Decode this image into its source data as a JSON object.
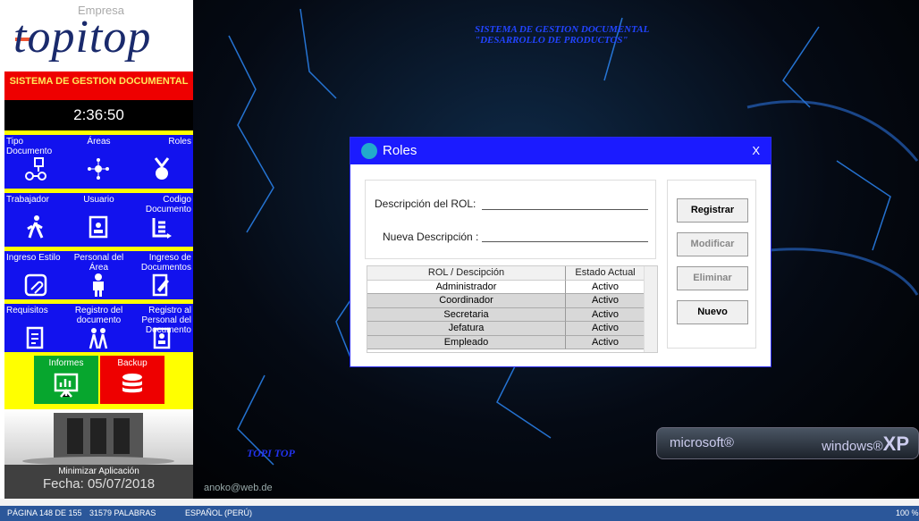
{
  "sidebar": {
    "company": "Empresa",
    "logo": "topitop",
    "system_title": "SISTEMA DE GESTION DOCUMENTAL",
    "clock": "2:36:50",
    "row1": [
      {
        "label": "Tipo Documento",
        "icon": "flow-icon"
      },
      {
        "label": "Áreas",
        "icon": "network-icon"
      },
      {
        "label": "Roles",
        "icon": "medal-icon"
      }
    ],
    "row2": [
      {
        "label": "Trabajador",
        "icon": "walking-person-icon"
      },
      {
        "label": "Usuario",
        "icon": "id-badge-icon"
      },
      {
        "label": "Codigo Documento",
        "icon": "list-arrow-icon"
      }
    ],
    "row3": [
      {
        "label": "Ingreso Estilo",
        "icon": "clip-icon"
      },
      {
        "label": "Personal del Área",
        "icon": "person-tie-icon"
      },
      {
        "label": "Ingreso de Documentos",
        "icon": "edit-doc-icon"
      }
    ],
    "row4": [
      {
        "label": "Requisitos",
        "icon": "checklist-icon"
      },
      {
        "label": "Registro del documento",
        "icon": "people-icon"
      },
      {
        "label": "Registro al Personal del Documento",
        "icon": "badge-doc-icon"
      }
    ],
    "informes": "Informes",
    "backup": "Backup",
    "minimize": "Minimizar Aplicación",
    "date": "Fecha: 05/07/2018"
  },
  "desktop": {
    "title_line1": "SISTEMA DE GESTION DOCUMENTAL",
    "title_line2": "\"DESARROLLO DE PRODUCTOS\"",
    "topitop": "TOPI TOP",
    "email": "anoko@web.de",
    "microsoft": "microsoft®",
    "windows": "windows®",
    "xp": "XP"
  },
  "dialog": {
    "title": "Roles",
    "close": "X",
    "desc_label": "Descripción del ROL:",
    "new_label": "Nueva Descripción :",
    "col1": "ROL / Descipción",
    "col2": "Estado Actual",
    "rows": [
      {
        "rol": "Administrador",
        "estado": "Activo"
      },
      {
        "rol": "Coordinador",
        "estado": "Activo"
      },
      {
        "rol": "Secretaria",
        "estado": "Activo"
      },
      {
        "rol": "Jefatura",
        "estado": "Activo"
      },
      {
        "rol": "Empleado",
        "estado": "Activo"
      }
    ],
    "buttons": {
      "registrar": "Registrar",
      "modificar": "Modificar",
      "eliminar": "Eliminar",
      "nuevo": "Nuevo"
    }
  },
  "statusbar": {
    "page": "PÁGINA 148 DE 155",
    "words": "31579 PALABRAS",
    "lang": "ESPAÑOL (PERÚ)",
    "zoom": "100 %"
  }
}
